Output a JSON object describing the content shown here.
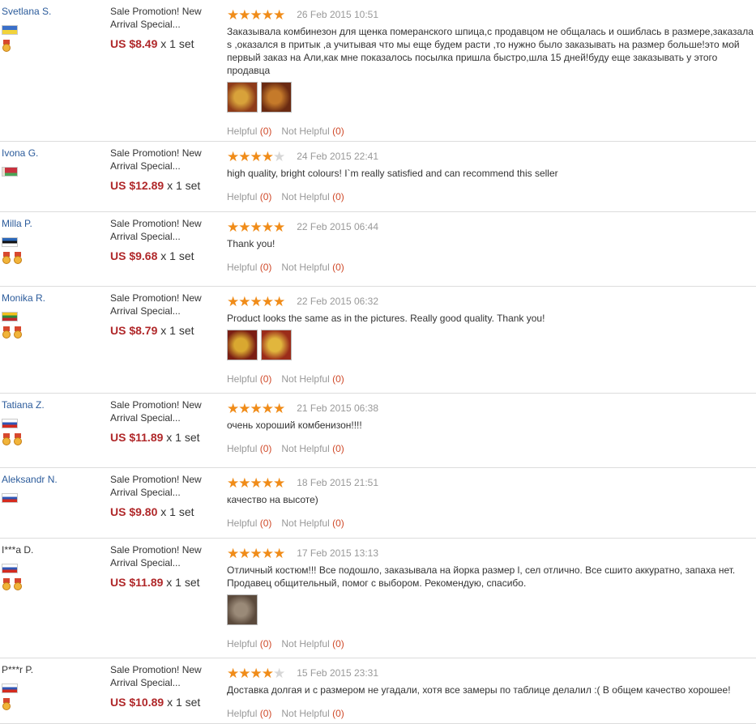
{
  "labels": {
    "helpful": "Helpful",
    "not_helpful": "Not Helpful",
    "x_set": "x 1 set"
  },
  "reviews": [
    {
      "user": "Svetlana S.",
      "order": "Sale Promotion! New Arrival Special...",
      "price": "US $8.49",
      "date": "26 Feb 2015 10:51",
      "text": "Заказывала комбинезон для щенка померанского шпица,с продавцом не общалась и ошиблась в размере,заказала s ,оказался в притык ,а учитывая что мы еще будем расти ,то нужно было заказывать на размер больше!это мой первый заказ на Али,как мне показалось посылка пришла быстро,шла 15 дней!буду еще заказывать у этого продавца",
      "helpful_count": "(0)",
      "not_helpful_count": "(0)"
    },
    {
      "user": "Ivona G.",
      "order": "Sale Promotion! New Arrival Special...",
      "price": "US $12.89",
      "date": "24 Feb 2015 22:41",
      "text": "high quality, bright colours! I`m really satisfied and can recommend this seller",
      "helpful_count": "(0)",
      "not_helpful_count": "(0)"
    },
    {
      "user": "Milla P.",
      "order": "Sale Promotion! New Arrival Special...",
      "price": "US $9.68",
      "date": "22 Feb 2015 06:44",
      "text": "Thank you!",
      "helpful_count": "(0)",
      "not_helpful_count": "(0)"
    },
    {
      "user": "Monika R.",
      "order": "Sale Promotion! New Arrival Special...",
      "price": "US $8.79",
      "date": "22 Feb 2015 06:32",
      "text": "Product looks the same as in the pictures. Really good quality. Thank you!",
      "helpful_count": "(0)",
      "not_helpful_count": "(0)"
    },
    {
      "user": "Tatiana Z.",
      "order": "Sale Promotion! New Arrival Special...",
      "price": "US $11.89",
      "date": "21 Feb 2015 06:38",
      "text": "очень хороший комбенизон!!!!",
      "helpful_count": "(0)",
      "not_helpful_count": "(0)"
    },
    {
      "user": "Aleksandr N.",
      "order": "Sale Promotion! New Arrival Special...",
      "price": "US $9.80",
      "date": "18 Feb 2015 21:51",
      "text": "качество на высоте)",
      "helpful_count": "(0)",
      "not_helpful_count": "(0)"
    },
    {
      "user": "I***a D.",
      "order": "Sale Promotion! New Arrival Special...",
      "price": "US $11.89",
      "date": "17 Feb 2015 13:13",
      "text": "Отличный костюм!!! Все подошло, заказывала на йорка размер l, сел отлично. Все сшито аккуратно, запаха нет. Продавец общительный, помог с выбором. Рекомендую, спасибо.",
      "helpful_count": "(0)",
      "not_helpful_count": "(0)"
    },
    {
      "user": "P***r P.",
      "order": "Sale Promotion! New Arrival Special...",
      "price": "US $10.89",
      "date": "15 Feb 2015 23:31",
      "text": "Доставка долгая и с размером не угадали, хотя все замеры по таблице делалил :( В общем качество хорошее!",
      "helpful_count": "(0)",
      "not_helpful_count": "(0)"
    }
  ],
  "colors": {
    "star_on": "#f08c19",
    "star_off": "#d7d7d7",
    "price": "#b0282a",
    "link": "#2b5b9b",
    "count": "#d04a2a"
  },
  "stars": [
    5,
    4,
    5,
    5,
    5,
    5,
    5,
    4
  ],
  "flags": [
    "Ukraine",
    "Belarus",
    "Estonia",
    "Lithuania",
    "Russia",
    "Russia",
    "Russia",
    "Russia"
  ],
  "medals": [
    1,
    0,
    2,
    2,
    2,
    0,
    2,
    1
  ],
  "photos": [
    2,
    0,
    0,
    2,
    0,
    0,
    1,
    0
  ]
}
